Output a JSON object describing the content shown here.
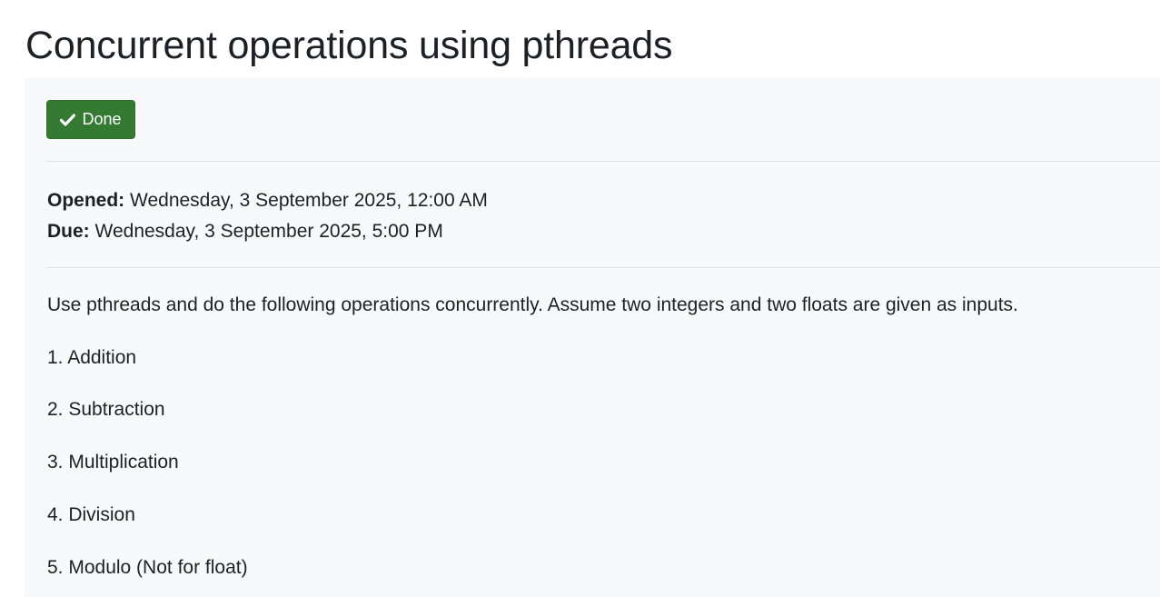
{
  "page": {
    "title": "Concurrent operations using pthreads"
  },
  "completion": {
    "done_label": "Done",
    "icon": "check-icon",
    "color": "#357a32"
  },
  "dates": {
    "opened_label": "Opened:",
    "opened_value": "Wednesday, 3 September 2025, 12:00 AM",
    "due_label": "Due:",
    "due_value": "Wednesday, 3 September 2025, 5:00 PM"
  },
  "description": {
    "intro": "Use pthreads and do the following operations concurrently. Assume two integers and two floats are given as inputs.",
    "items": [
      "1. Addition",
      "2. Subtraction",
      "3. Multiplication",
      "4. Division",
      "5. Modulo (Not for float)"
    ]
  }
}
